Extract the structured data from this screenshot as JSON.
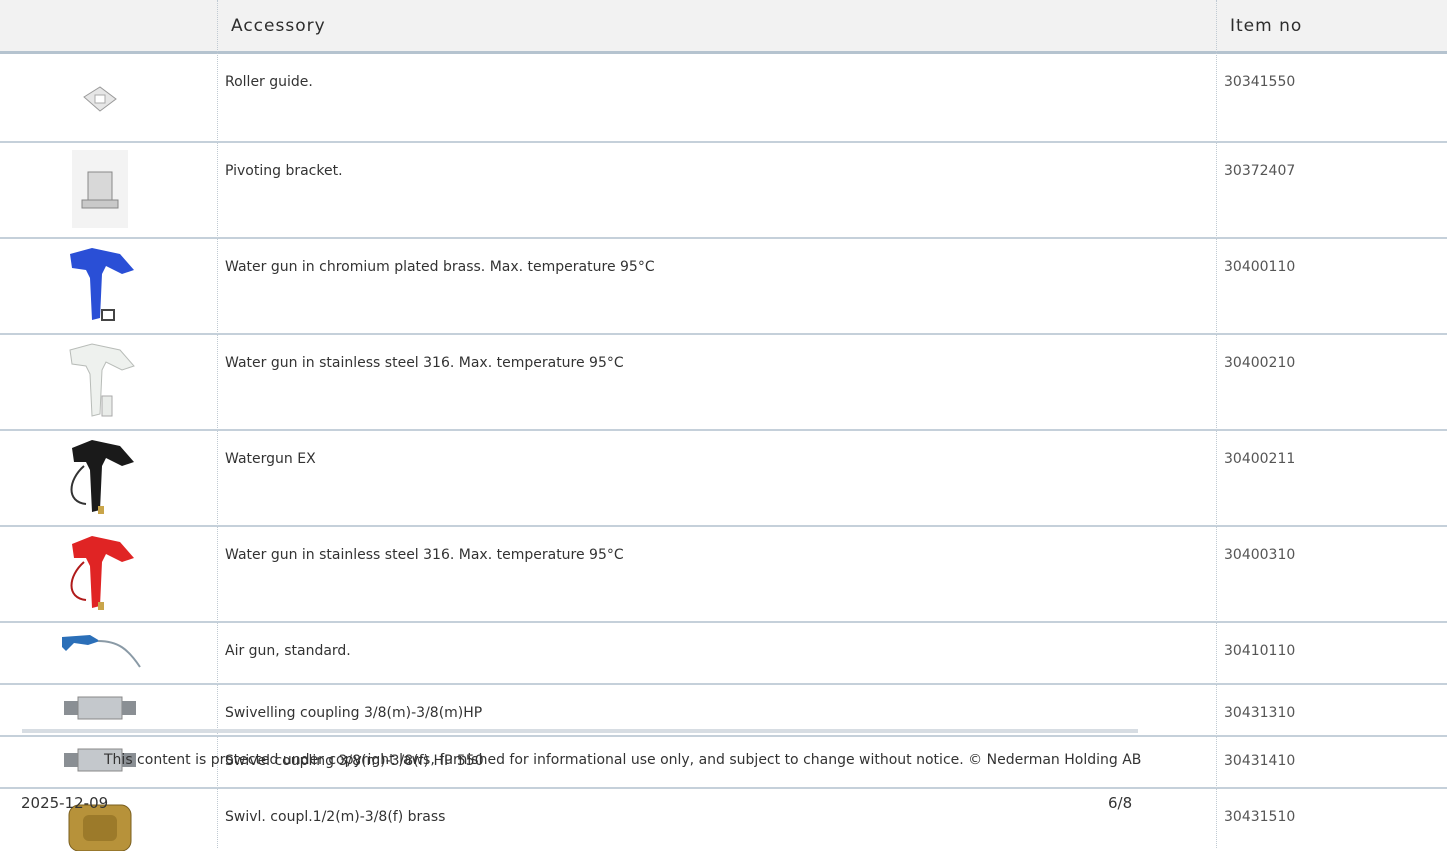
{
  "header": {
    "accessory": "Accessory",
    "item_no": "Item no"
  },
  "rows": [
    {
      "desc": "Roller guide.",
      "num": "30341550",
      "icon": "roller-guide-icon"
    },
    {
      "desc": "Pivoting bracket.",
      "num": "30372407",
      "icon": "pivoting-bracket-icon"
    },
    {
      "desc": "Water gun in chromium plated brass. Max. temperature 95°C",
      "num": "30400110",
      "icon": "blue-water-gun-icon"
    },
    {
      "desc": "Water gun in stainless steel 316. Max. temperature 95°C",
      "num": "30400210",
      "icon": "white-water-gun-icon"
    },
    {
      "desc": "Watergun EX",
      "num": "30400211",
      "icon": "black-water-gun-icon"
    },
    {
      "desc": "Water gun in stainless steel 316. Max. temperature 95°C",
      "num": "30400310",
      "icon": "red-water-gun-icon"
    },
    {
      "desc": "Air gun, standard.",
      "num": "30410110",
      "icon": "air-gun-icon"
    },
    {
      "desc": "Swivelling coupling 3/8(m)-3/8(m)HP",
      "num": "30431310",
      "icon": "swivel-coupling-icon"
    },
    {
      "desc": "Swivel coupling 3/8(m)-3/8(f) HP 550",
      "num": "30431410",
      "icon": "swivel-coupling-icon"
    },
    {
      "desc": "Swivl. coupl.1/2(m)-3/8(f) brass",
      "num": "30431510",
      "icon": "brass-coupling-icon"
    }
  ],
  "footer": {
    "notice": "This content is protected under copyright laws, furnished for informational use only, and subject to change without notice. © Nederman Holding AB",
    "date": "2025-12-09",
    "page": "6/8"
  }
}
